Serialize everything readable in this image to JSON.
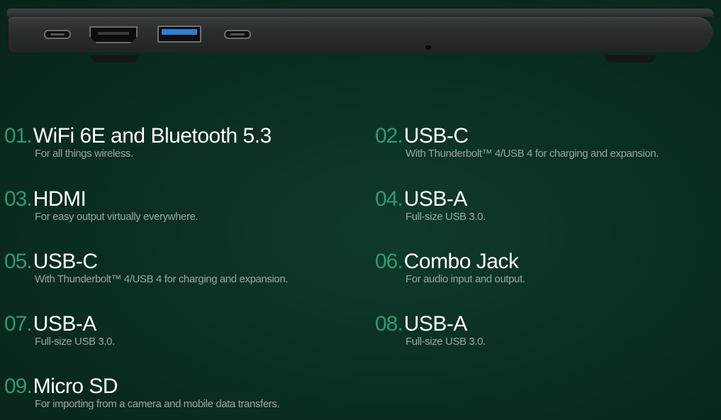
{
  "features": [
    {
      "num": "01.",
      "title": "WiFi 6E and Bluetooth 5.3",
      "desc": "For all things wireless."
    },
    {
      "num": "02.",
      "title": "USB-C",
      "desc": "With Thunderbolt™ 4/USB 4 for charging and expansion."
    },
    {
      "num": "03.",
      "title": "HDMI",
      "desc": "For easy output virtually everywhere."
    },
    {
      "num": "04.",
      "title": "USB-A",
      "desc": "Full-size USB 3.0."
    },
    {
      "num": "05.",
      "title": "USB-C",
      "desc": "With Thunderbolt™ 4/USB 4 for charging and expansion."
    },
    {
      "num": "06.",
      "title": "Combo Jack",
      "desc": "For audio input and output."
    },
    {
      "num": "07.",
      "title": "USB-A",
      "desc": "Full-size USB 3.0."
    },
    {
      "num": "08.",
      "title": "USB-A",
      "desc": "Full-size USB 3.0."
    },
    {
      "num": "09.",
      "title": "Micro SD",
      "desc": "For importing from a camera and mobile data transfers."
    }
  ],
  "colors": {
    "accent": "#2d9a72",
    "background": "#0b2f24",
    "usb_a_blue": "#2e7fd6"
  }
}
